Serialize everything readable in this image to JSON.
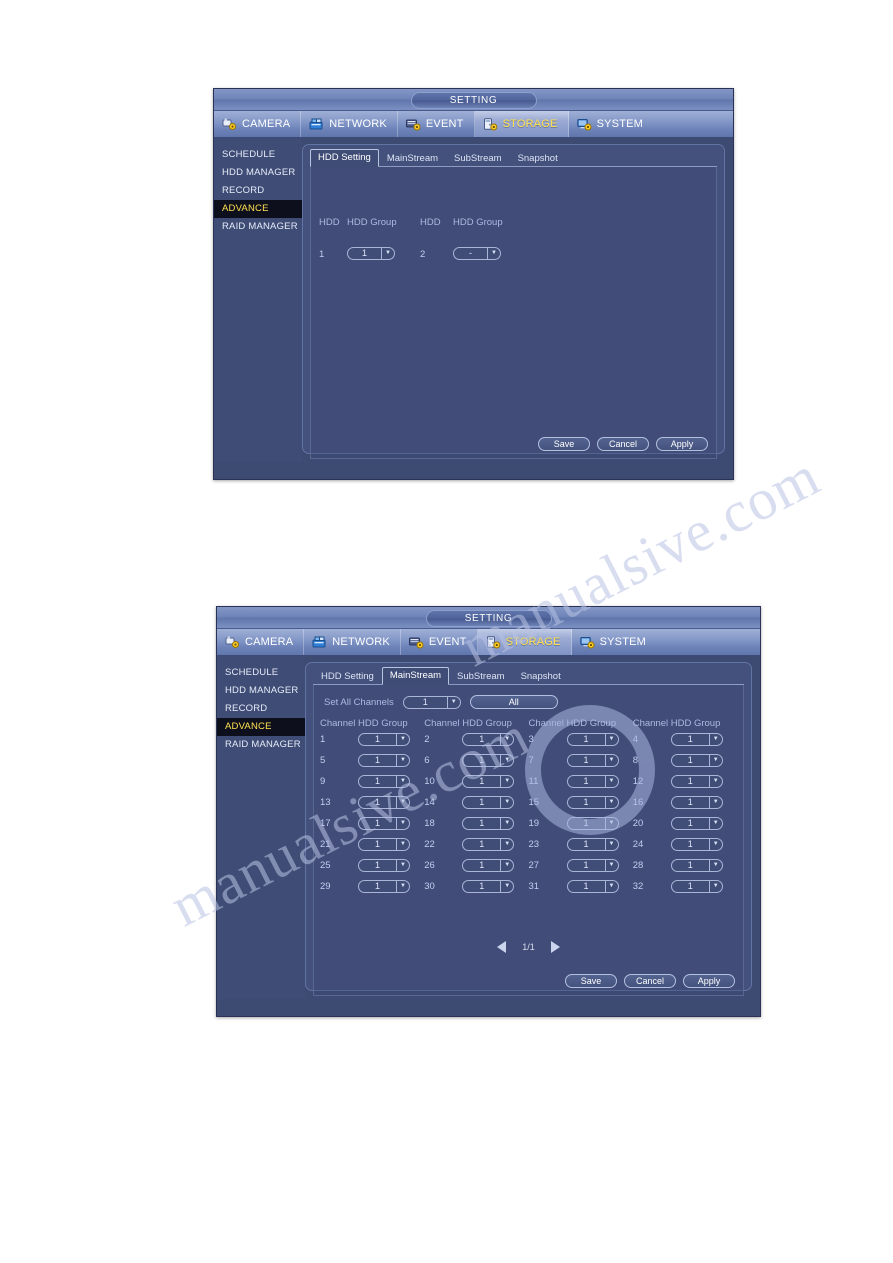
{
  "nav": {
    "title": "SETTING",
    "items": [
      {
        "label": "CAMERA",
        "icon": "camera-gear-icon",
        "active": false
      },
      {
        "label": "NETWORK",
        "icon": "network-icon",
        "active": false
      },
      {
        "label": "EVENT",
        "icon": "event-gear-icon",
        "active": false
      },
      {
        "label": "STORAGE",
        "icon": "storage-gear-icon",
        "active": true
      },
      {
        "label": "SYSTEM",
        "icon": "system-gear-icon",
        "active": false
      }
    ]
  },
  "sidebar": {
    "items": [
      {
        "label": "SCHEDULE",
        "active": false
      },
      {
        "label": "HDD MANAGER",
        "active": false
      },
      {
        "label": "RECORD",
        "active": false
      },
      {
        "label": "ADVANCE",
        "active": true
      },
      {
        "label": "RAID MANAGER",
        "active": false
      }
    ]
  },
  "tabs": {
    "labels": [
      "HDD Setting",
      "MainStream",
      "SubStream",
      "Snapshot"
    ],
    "active_dialog1": "HDD Setting",
    "active_dialog2": "MainStream"
  },
  "buttons": {
    "save": "Save",
    "cancel": "Cancel",
    "apply": "Apply",
    "all": "All"
  },
  "dialog1": {
    "headers": {
      "hdd": "HDD",
      "hdd_group": "HDD Group"
    },
    "rows": [
      {
        "hdd": "1",
        "group": "1"
      },
      {
        "hdd": "2",
        "group": "-"
      }
    ]
  },
  "dialog2": {
    "set_all_label": "Set All Channels",
    "set_all_value": "1",
    "column_headers": {
      "channel": "Channel",
      "hdd_group": "HDD Group"
    },
    "channels": [
      {
        "channel": "1",
        "group": "1"
      },
      {
        "channel": "2",
        "group": "1"
      },
      {
        "channel": "3",
        "group": "1"
      },
      {
        "channel": "4",
        "group": "1"
      },
      {
        "channel": "5",
        "group": "1"
      },
      {
        "channel": "6",
        "group": "1"
      },
      {
        "channel": "7",
        "group": "1"
      },
      {
        "channel": "8",
        "group": "1"
      },
      {
        "channel": "9",
        "group": "1"
      },
      {
        "channel": "10",
        "group": "1"
      },
      {
        "channel": "11",
        "group": "1"
      },
      {
        "channel": "12",
        "group": "1"
      },
      {
        "channel": "13",
        "group": "1"
      },
      {
        "channel": "14",
        "group": "1"
      },
      {
        "channel": "15",
        "group": "1"
      },
      {
        "channel": "16",
        "group": "1"
      },
      {
        "channel": "17",
        "group": "1"
      },
      {
        "channel": "18",
        "group": "1"
      },
      {
        "channel": "19",
        "group": "1"
      },
      {
        "channel": "20",
        "group": "1"
      },
      {
        "channel": "21",
        "group": "1"
      },
      {
        "channel": "22",
        "group": "1"
      },
      {
        "channel": "23",
        "group": "1"
      },
      {
        "channel": "24",
        "group": "1"
      },
      {
        "channel": "25",
        "group": "1"
      },
      {
        "channel": "26",
        "group": "1"
      },
      {
        "channel": "27",
        "group": "1"
      },
      {
        "channel": "28",
        "group": "1"
      },
      {
        "channel": "29",
        "group": "1"
      },
      {
        "channel": "30",
        "group": "1"
      },
      {
        "channel": "31",
        "group": "1"
      },
      {
        "channel": "32",
        "group": "1"
      }
    ],
    "pagination": "1/1"
  },
  "watermark": {
    "line1": "manualsive.com",
    "line2": "manualsive.com"
  },
  "colors": {
    "accent_active": "#ffe14f",
    "dialog_bg": "#3d4a72",
    "nav_gradient_top": "#9fb0d6",
    "label_text": "#aeb9e2"
  }
}
